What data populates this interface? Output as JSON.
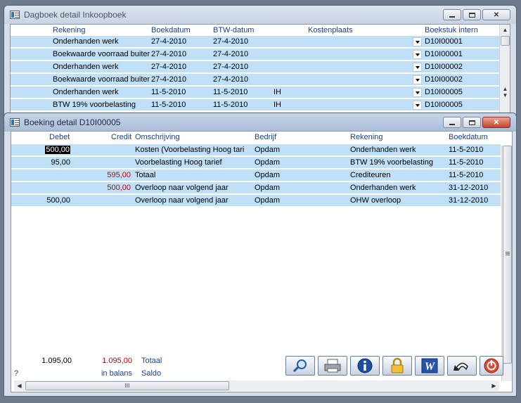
{
  "win1": {
    "title": "Dagboek detail Inkoopboek",
    "headers": {
      "rekening": "Rekening",
      "boekdatum": "Boekdatum",
      "btwdatum": "BTW-datum",
      "kostenplaats": "Kostenplaats",
      "boekstuk": "Boekstuk intern"
    },
    "rows": [
      {
        "rekening": "Onderhanden werk",
        "boekdatum": "27-4-2010",
        "btwdatum": "27-4-2010",
        "kostenplaats": "",
        "boekstuk": "D10I00001"
      },
      {
        "rekening": "Boekwaarde voorraad buiten",
        "boekdatum": "27-4-2010",
        "btwdatum": "27-4-2010",
        "kostenplaats": "",
        "boekstuk": "D10I00001"
      },
      {
        "rekening": "Onderhanden werk",
        "boekdatum": "27-4-2010",
        "btwdatum": "27-4-2010",
        "kostenplaats": "",
        "boekstuk": "D10I00002"
      },
      {
        "rekening": "Boekwaarde voorraad buiten",
        "boekdatum": "27-4-2010",
        "btwdatum": "27-4-2010",
        "kostenplaats": "",
        "boekstuk": "D10I00002"
      },
      {
        "rekening": "Onderhanden werk",
        "boekdatum": "11-5-2010",
        "btwdatum": "11-5-2010",
        "kostenplaats": "IH",
        "boekstuk": "D10I00005"
      },
      {
        "rekening": "BTW 19% voorbelasting",
        "boekdatum": "11-5-2010",
        "btwdatum": "11-5-2010",
        "kostenplaats": "IH",
        "boekstuk": "D10I00005"
      }
    ]
  },
  "win2": {
    "title": "Boeking detail D10I00005",
    "headers": {
      "debet": "Debet",
      "credit": "Credit",
      "omschrijving": "Omschrijving",
      "bedrijf": "Bedrijf",
      "rekening": "Rekening",
      "boekdatum": "Boekdatum"
    },
    "rows": [
      {
        "debet": "500,00",
        "credit": "",
        "omschrijving": "Kosten (Voorbelasting Hoog tari",
        "bedrijf": "Opdam",
        "rekening": "Onderhanden werk",
        "boekdatum": "11-5-2010"
      },
      {
        "debet": "95,00",
        "credit": "",
        "omschrijving": "Voorbelasting Hoog tarief",
        "bedrijf": "Opdam",
        "rekening": "BTW 19% voorbelasting",
        "boekdatum": "11-5-2010"
      },
      {
        "debet": "",
        "credit": "595,00",
        "omschrijving": "Totaal",
        "bedrijf": "Opdam",
        "rekening": "Crediteuren",
        "boekdatum": "11-5-2010"
      },
      {
        "debet": "",
        "credit": "500,00",
        "omschrijving": "Overloop naar volgend jaar",
        "bedrijf": "Opdam",
        "rekening": "Onderhanden werk",
        "boekdatum": "31-12-2010"
      },
      {
        "debet": "500,00",
        "credit": "",
        "omschrijving": "Overloop naar volgend jaar",
        "bedrijf": "Opdam",
        "rekening": "OHW overloop",
        "boekdatum": "31-12-2010"
      }
    ],
    "footer": {
      "total_debet": "1.095,00",
      "total_credit": "1.095,00",
      "total_label": "Totaal",
      "question": "?",
      "balance_status": "in balans",
      "saldo_label": "Saldo"
    },
    "hscroll_grip": "III"
  },
  "colors": {
    "row_blue": "#bfe0f7",
    "header_blue": "#1c3f8c",
    "credit_red": "#c00000"
  },
  "toolbar": [
    "search-icon",
    "print-icon",
    "info-icon",
    "lock-icon",
    "word-icon",
    "undo-icon",
    "power-icon"
  ]
}
